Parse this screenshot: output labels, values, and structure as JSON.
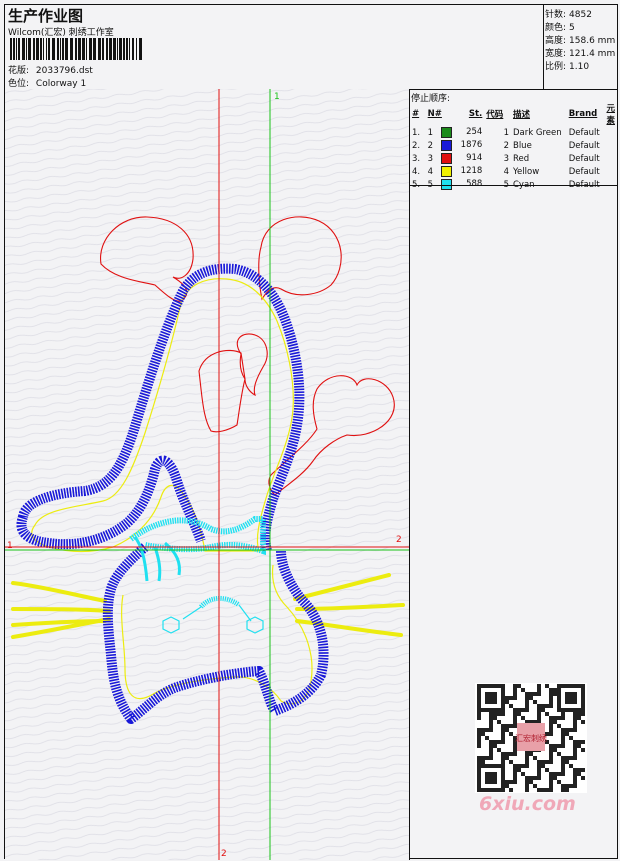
{
  "header": {
    "title": "生产作业图",
    "subtitle": "Wilcom(汇宏) 刺绣工作室",
    "design_label": "花版:",
    "design_value": "2033796.dst",
    "colorway_label": "色位:",
    "colorway_value": "Colorway 1"
  },
  "stats": [
    {
      "label": "针数:",
      "value": "4852"
    },
    {
      "label": "颜色:",
      "value": "5"
    },
    {
      "label": "高度:",
      "value": "158.6 mm"
    },
    {
      "label": "宽度:",
      "value": "121.4 mm"
    },
    {
      "label": "比例:",
      "value": "1.10"
    }
  ],
  "legend": {
    "title": "停止顺序:",
    "columns": [
      "#",
      "N#",
      "St.",
      "代码",
      "描述",
      "Brand",
      "元素"
    ],
    "rows": [
      {
        "idx": "1.",
        "n": "1",
        "color": "#1a8a1a",
        "st": "254",
        "code": "1",
        "desc": "Dark Green",
        "brand": "Default"
      },
      {
        "idx": "2.",
        "n": "2",
        "color": "#1a1ad8",
        "st": "1876",
        "code": "2",
        "desc": "Blue",
        "brand": "Default"
      },
      {
        "idx": "3.",
        "n": "3",
        "color": "#e01010",
        "st": "914",
        "code": "3",
        "desc": "Red",
        "brand": "Default"
      },
      {
        "idx": "4.",
        "n": "4",
        "color": "#f0f000",
        "st": "1218",
        "code": "4",
        "desc": "Yellow",
        "brand": "Default"
      },
      {
        "idx": "5.",
        "n": "5",
        "color": "#20e0f0",
        "st": "588",
        "code": "5",
        "desc": "Cyan",
        "brand": "Default"
      }
    ]
  },
  "axes": {
    "v1": "1",
    "v2": "2",
    "h1": "1",
    "h2": "2"
  },
  "watermark": "6xiu.com",
  "qr_stamp": "汇宏刺绣"
}
